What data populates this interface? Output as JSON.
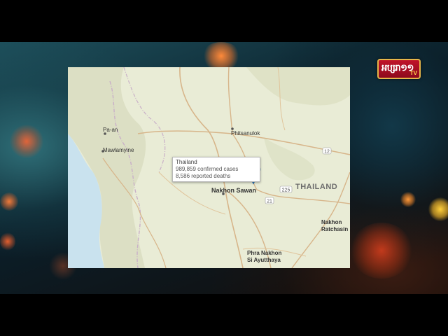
{
  "channel_logo": {
    "brand": "អប្សរា១១",
    "tv": "TV",
    "brand_color": "#c0132a",
    "border_color": "#e6b64a"
  },
  "map": {
    "country_label": "THAILAND",
    "cities": {
      "pa_an": "Pa-an",
      "mawlamyine": "Mawlamyine",
      "phitsanulok": "Phitsanulok",
      "nakhon_sawan": "Nakhon Sawan",
      "nakhon_ratchasima_1": "Nakhon",
      "nakhon_ratchasima_2": "Ratchasin",
      "phra_nakhon_1": "Phra Nakhon",
      "phra_nakhon_2": "Si Ayutthaya"
    },
    "highway_shields": {
      "h12": "12",
      "h225": "225",
      "h21": "21"
    },
    "marker": {
      "icon": "map-pin-icon",
      "color": "#2f86d6"
    },
    "water_color": "#c9e2ee",
    "land_color": "#e9ecd6"
  },
  "popup": {
    "title": "Thailand",
    "confirmed": "989,859 confirmed cases",
    "deaths": "8,586 reported deaths"
  }
}
